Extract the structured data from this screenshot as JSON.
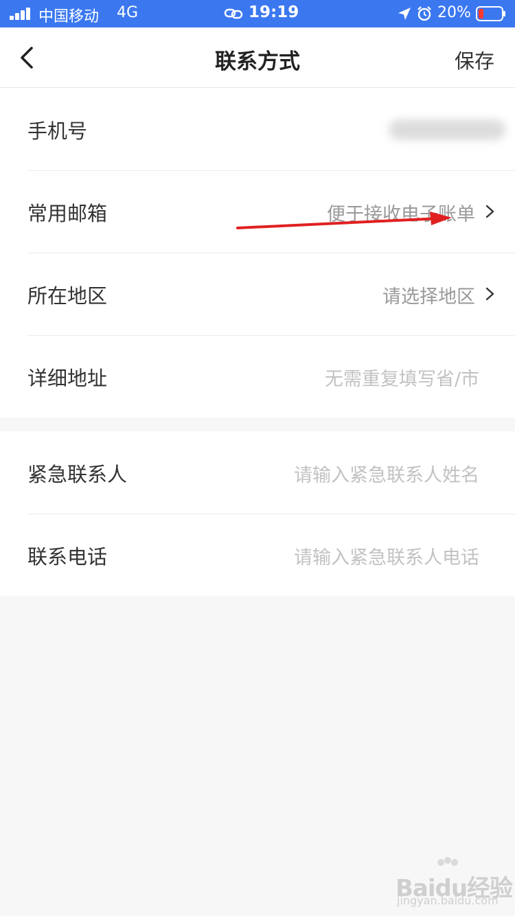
{
  "status_bar": {
    "carrier": "中国移动",
    "network": "4G",
    "time": "19:19",
    "battery_percent": "20%",
    "bg_color": "#3b78f0"
  },
  "nav": {
    "title": "联系方式",
    "save_label": "保存",
    "back_icon": "chevron-left-icon"
  },
  "groups": [
    {
      "rows": [
        {
          "label": "手机号",
          "value": "",
          "blurred": true
        },
        {
          "label": "常用邮箱",
          "value": "便于接收电子账单",
          "chevron": true
        },
        {
          "label": "所在地区",
          "value": "请选择地区",
          "chevron": true
        },
        {
          "label": "详细地址",
          "placeholder": "无需重复填写省/市"
        }
      ]
    },
    {
      "rows": [
        {
          "label": "紧急联系人",
          "placeholder": "请输入紧急联系人姓名"
        },
        {
          "label": "联系电话",
          "placeholder": "请输入紧急联系人电话"
        }
      ]
    }
  ],
  "annotation": {
    "arrow_color": "#e02020"
  },
  "watermark": {
    "text": "Baidu经验",
    "sub": "jingyan.baidu.com"
  }
}
